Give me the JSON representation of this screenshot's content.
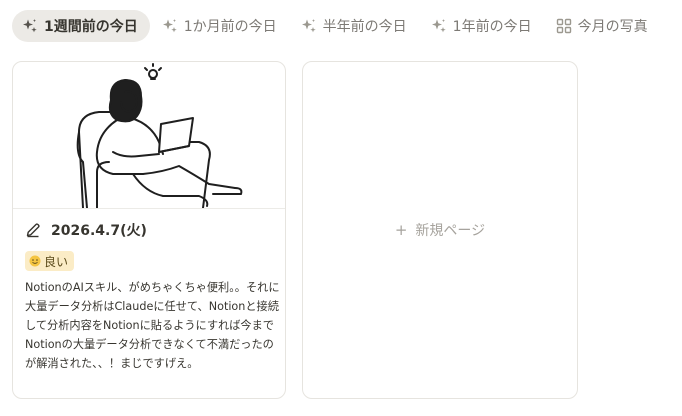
{
  "tabs": [
    {
      "label": "1週間前の今日",
      "icon": "sparkle-icon",
      "active": true
    },
    {
      "label": "1か月前の今日",
      "icon": "sparkle-icon",
      "active": false
    },
    {
      "label": "半年前の今日",
      "icon": "sparkle-icon",
      "active": false
    },
    {
      "label": "1年前の今日",
      "icon": "sparkle-icon",
      "active": false
    },
    {
      "label": "今月の写真",
      "icon": "grid-icon",
      "active": false
    }
  ],
  "entry": {
    "date": "2026.4.7(火)",
    "mood": "良い",
    "mood_color": "#fbecc6",
    "body": "NotionのAIスキル、がめちゃくちゃ便利。。それに大量データ分析はClaudeに任せて、Notionと接続して分析内容をNotionに貼るようにすれば今までNotionの大量データ分析できなくて不満だったのが解消された、、！まじですげえ。"
  },
  "new_page": {
    "plus": "+",
    "label": "新規ページ"
  }
}
